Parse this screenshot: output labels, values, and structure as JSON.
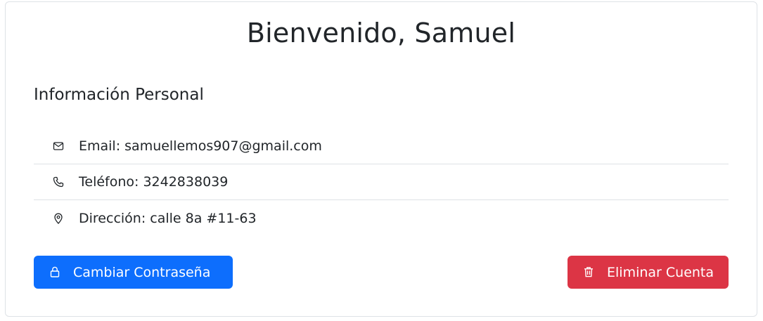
{
  "header": {
    "title": "Bienvenido, Samuel"
  },
  "personal_info": {
    "section_title": "Información Personal",
    "items": [
      {
        "icon": "envelope-icon",
        "text": "Email: samuellemos907@gmail.com"
      },
      {
        "icon": "phone-icon",
        "text": "Teléfono: 3242838039"
      },
      {
        "icon": "map-pin-icon",
        "text": "Dirección: calle 8a #11-63"
      }
    ]
  },
  "actions": {
    "change_password_label": "Cambiar Contraseña",
    "delete_account_label": "Eliminar Cuenta"
  },
  "colors": {
    "primary": "#0d6efd",
    "danger": "#dc3545",
    "border": "#dee2e6",
    "text": "#212529"
  }
}
